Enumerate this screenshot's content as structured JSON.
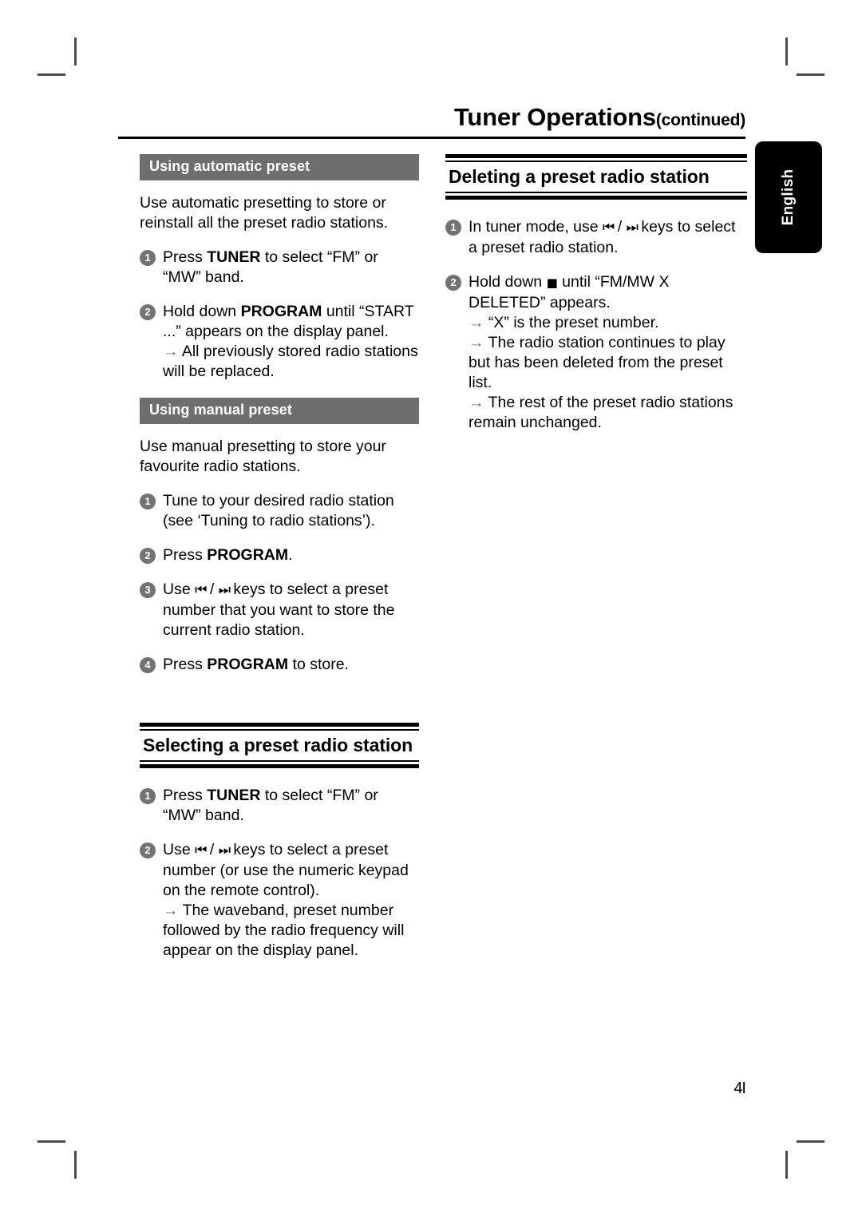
{
  "page": {
    "title": "Tuner Operations",
    "title_suffix": "(continued)",
    "number": "4I",
    "language_tab": "English"
  },
  "left_column": {
    "section_auto": {
      "bar_label": "Using automatic preset",
      "intro": "Use automatic presetting to store or reinstall all the preset radio stations.",
      "steps": [
        {
          "num": "1",
          "pre": "Press ",
          "bold": "TUNER",
          "post": " to select “FM” or “MW” band.",
          "notes": []
        },
        {
          "num": "2",
          "pre": "Hold down ",
          "bold": "PROGRAM",
          "post": " until “START ...” appears on the display panel.",
          "notes": [
            "All previously stored radio stations will be replaced."
          ]
        }
      ]
    },
    "section_manual": {
      "bar_label": "Using manual preset",
      "intro": "Use manual presetting to store your favourite radio stations.",
      "steps": [
        {
          "num": "1",
          "pre": "Tune to your desired radio station (see ‘Tuning to radio stations’).",
          "bold": "",
          "post": "",
          "notes": []
        },
        {
          "num": "2",
          "pre": "Press ",
          "bold": "PROGRAM",
          "post": ".",
          "notes": []
        },
        {
          "num": "3",
          "pre": "Use ",
          "glyph_prev": "skip-previous-icon",
          "glyph_next": "skip-next-icon",
          "post": " keys to select a preset number that you want to store the current radio station.",
          "notes": []
        },
        {
          "num": "4",
          "pre": "Press ",
          "bold": "PROGRAM",
          "post": " to store.",
          "notes": []
        }
      ]
    },
    "section_selecting": {
      "heading": "Selecting a preset radio station",
      "steps": [
        {
          "num": "1",
          "pre": "Press ",
          "bold": "TUNER",
          "post": " to select “FM” or “MW” band.",
          "notes": []
        },
        {
          "num": "2",
          "pre": "Use ",
          "post": " keys to select a preset number (or use the numeric keypad on the remote control).",
          "notes": [
            "The waveband, preset number followed by the radio frequency will appear on the display panel."
          ]
        }
      ]
    }
  },
  "right_column": {
    "section_deleting": {
      "heading": "Deleting a preset radio station",
      "steps": [
        {
          "num": "1",
          "pre": "In tuner mode, use ",
          "post": " keys to select a preset radio station.",
          "notes": []
        },
        {
          "num": "2",
          "pre": "Hold down ",
          "stop_glyph": "stop-square-icon",
          "post": " until “FM/MW X DELETED” appears.",
          "notes": [
            "“X” is the preset number.",
            "The radio station continues to play but has been deleted from the preset list.",
            "The rest of the preset radio stations remain unchanged."
          ]
        }
      ]
    }
  },
  "glyphs": {
    "prev": "⏮",
    "next": "⏭",
    "stop": "■",
    "arrow": "→"
  },
  "colors": {
    "bar_gray": "#6e6e6e",
    "bullet_gray": "#737373",
    "arrow_gray": "#6b6b6b",
    "rule_black": "#000000",
    "tab_black": "#000000"
  }
}
